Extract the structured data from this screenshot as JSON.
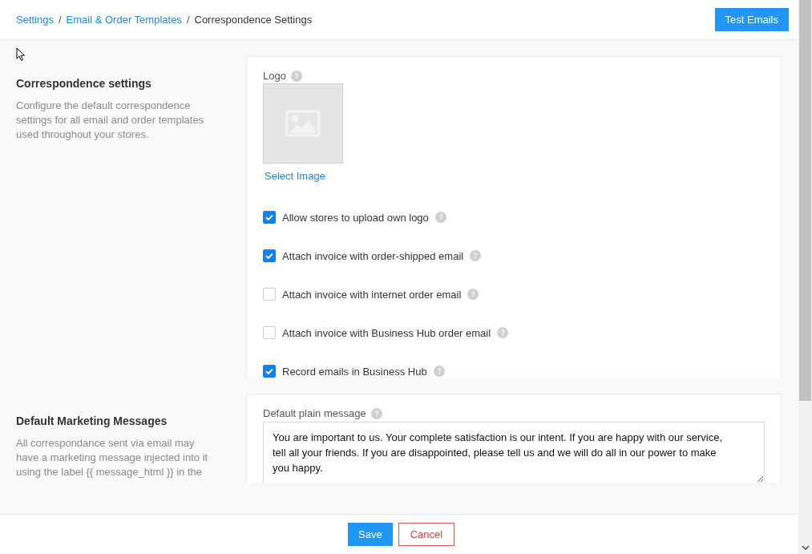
{
  "breadcrumb": [
    {
      "label": "Settings",
      "kind": "link"
    },
    {
      "label": "Email & Order Templates",
      "kind": "link",
      "separator_before": "/"
    },
    {
      "label": "Correspondence Settings",
      "kind": "current",
      "separator_before": "/"
    }
  ],
  "header_button": "Test Emails",
  "sections": [
    {
      "title": "Correspondence settings",
      "description": "Configure the default correspondence settings for all email and order templates used throughout your stores.",
      "logo": {
        "label": "Logo",
        "help": true,
        "button": "Select Image"
      },
      "options": [
        {
          "label": "Allow stores to upload own logo",
          "checked": true,
          "help": true
        },
        {
          "label": "Attach invoice with order-shipped email",
          "checked": true,
          "help": true
        },
        {
          "label": "Attach invoice with internet order email",
          "checked": false,
          "help": true
        },
        {
          "label": "Attach invoice with Business Hub order email",
          "checked": false,
          "help": true
        },
        {
          "label": "Record emails in Business Hub",
          "checked": true,
          "help": true
        }
      ]
    },
    {
      "title": "Default Marketing Messages",
      "description": "All correspondance sent via email may have a marketing message injected into it using the label {{ message_html }} in the",
      "fields": [
        {
          "label": "Default plain message",
          "help": true,
          "value": "You are important to us. Your complete satisfaction is our intent. If you are happy with our service, tell all your friends. If you are disappointed, please tell us and we will do all in our power to make you happy."
        }
      ]
    }
  ],
  "footer": {
    "buttons": [
      {
        "label": "Save",
        "kind": "primary"
      },
      {
        "label": "Cancel",
        "kind": "danger"
      }
    ]
  }
}
